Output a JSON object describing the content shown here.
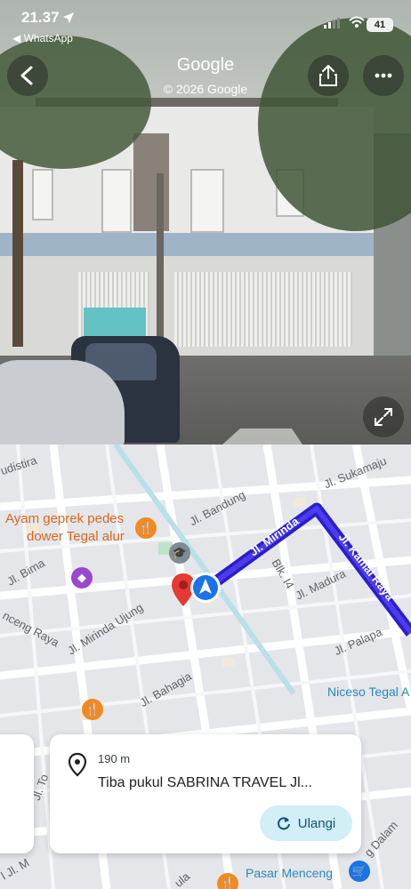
{
  "status_bar": {
    "time": "21.37",
    "back_app": "◀ WhatsApp",
    "battery": "41"
  },
  "header": {
    "title": "Google",
    "subtitle": "© 2026 Google"
  },
  "map": {
    "labels": {
      "dhistira": "udistira",
      "bandung": "Jl. Bandung",
      "sukamaju": "Jl. Sukamaju",
      "bima": "Jl. Bima",
      "mirinda": "Jl. Mirinda",
      "kamal_raya": "Jl. Kamal Raya",
      "blk": "Blk. I4",
      "madura": "Jl. Madura",
      "menceng_raya": "nceng Raya",
      "mirinda_ujung": "Jl. Mirinda Ujung",
      "palapa": "Jl. Palapa",
      "bahagia": "Jl. Bahagia",
      "to": "Jl. To",
      "dalam": "g Dalam",
      "jl_m": "l Jl. M",
      "ula": "ula"
    },
    "pois": {
      "ayam_line1": "Ayam geprek pedes",
      "ayam_line2": "dower Tegal alur",
      "niceso": "Niceso Tegal A",
      "pasar": "Pasar Menceng"
    },
    "route_color": "#2a1ec8"
  },
  "card": {
    "distance": "190 m",
    "instruction": "Tiba pukul SABRINA TRAVEL Jl...",
    "retry_label": "Ulangi"
  }
}
